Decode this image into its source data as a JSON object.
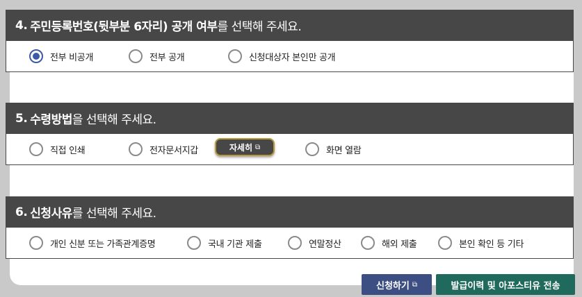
{
  "section4": {
    "num": "4.",
    "bold": "주민등록번호(뒷부분 6자리) 공개 여부",
    "rest": "를 선택해 주세요.",
    "options": [
      {
        "label": "전부 비공개",
        "selected": true
      },
      {
        "label": "전부 공개",
        "selected": false
      },
      {
        "label": "신청대상자 본인만 공개",
        "selected": false
      }
    ]
  },
  "section5": {
    "num": "5.",
    "bold": "수령방법",
    "rest": "을 선택해 주세요.",
    "options": [
      {
        "label": "직접 인쇄",
        "selected": false
      },
      {
        "label": "전자문서지갑",
        "selected": false
      },
      {
        "label": "화면 열람",
        "selected": false
      }
    ],
    "detail_button": "자세히"
  },
  "section6": {
    "num": "6.",
    "bold": "신청사유",
    "rest": "를 선택해 주세요.",
    "options": [
      {
        "label": "개인 신분 또는 가족관계증명",
        "selected": false
      },
      {
        "label": "국내 기관 제출",
        "selected": false
      },
      {
        "label": "연말정산",
        "selected": false
      },
      {
        "label": "해외 제출",
        "selected": false
      },
      {
        "label": "본인 확인 등 기타",
        "selected": false
      }
    ]
  },
  "buttons": {
    "apply": "신청하기",
    "send": "발급이력 및 아포스티유 전송"
  },
  "colors": {
    "header_bg": "#474747",
    "radio_selected": "#3b5ba8",
    "apply_bg": "#3d4f82",
    "send_bg": "#1f6a5c"
  }
}
